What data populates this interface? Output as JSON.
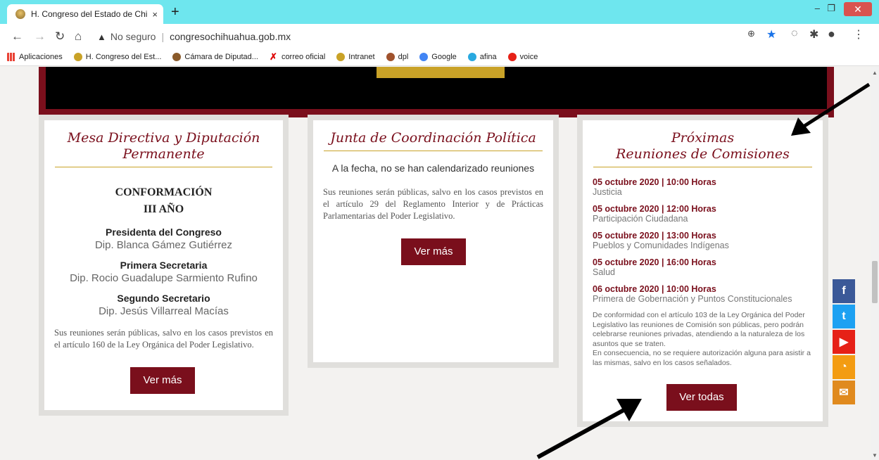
{
  "browser": {
    "tab_title": "H. Congreso del Estado de Chihu",
    "tab_close": "×",
    "new_tab": "+",
    "security_label": "No seguro",
    "url": "congresochihuahua.gob.mx",
    "bookmarks": [
      {
        "label": "Aplicaciones",
        "icon": "apps-grid-icon"
      },
      {
        "label": "H. Congreso del Est...",
        "icon": "congreso-icon"
      },
      {
        "label": "Cámara de Diputad...",
        "icon": "camara-icon"
      },
      {
        "label": "correo oficial",
        "icon": "x-mail-icon"
      },
      {
        "label": "Intranet",
        "icon": "congreso-icon"
      },
      {
        "label": "dpl",
        "icon": "dpl-icon"
      },
      {
        "label": "Google",
        "icon": "google-icon"
      },
      {
        "label": "afina",
        "icon": "afina-icon"
      },
      {
        "label": "voice",
        "icon": "youtube-icon"
      }
    ]
  },
  "cards": {
    "mesa": {
      "title_line1": "Mesa Directiva y Diputación",
      "title_line2": "Permanente",
      "conf_line1": "CONFORMACIÓN",
      "conf_line2": "III AÑO",
      "members": [
        {
          "role": "Presidenta del Congreso",
          "name": "Dip. Blanca Gámez Gutiérrez"
        },
        {
          "role": "Primera Secretaria",
          "name": "Dip. Rocio Guadalupe Sarmiento Rufino"
        },
        {
          "role": "Segundo Secretario",
          "name": "Dip. Jesús Villarreal Macías"
        }
      ],
      "note": "Sus reuniones serán públicas, salvo en los casos previstos en el artículo 160 de la Ley Orgánica del Poder Legislativo.",
      "button": "Ver más"
    },
    "junta": {
      "title": "Junta de Coordinación Política",
      "no_meetings": "A la fecha, no se han calendarizado reuniones",
      "note": "Sus reuniones serán públicas, salvo en los casos previstos en el artículo 29 del Reglamento Interior y de Prácticas Parlamentarias del Poder Legislativo.",
      "button": "Ver más"
    },
    "comisiones": {
      "title_line1": "Próximas",
      "title_line2": "Reuniones de Comisiones",
      "meetings": [
        {
          "date": "05 octubre 2020 | 10:00 Horas",
          "committee": "Justicia"
        },
        {
          "date": "05 octubre 2020 | 12:00 Horas",
          "committee": "Participación Ciudadana"
        },
        {
          "date": "05 octubre 2020 | 13:00 Horas",
          "committee": "Pueblos y Comunidades Indígenas"
        },
        {
          "date": "05 octubre 2020 | 16:00 Horas",
          "committee": "Salud"
        },
        {
          "date": "06 octubre 2020 | 10:00 Horas",
          "committee": "Primera de Gobernación y Puntos Constitucionales"
        }
      ],
      "legal_1": "De conformidad con el artículo 103 de la Ley Orgánica del Poder Legislativo las reuniones de Comisión son públicas, pero podrán celebrarse reuniones privadas, atendiendo a la naturaleza de los asuntos que se traten.",
      "legal_2": "En consecuencia, no se requiere autorización alguna para asistir a las mismas, salvo en los casos señalados.",
      "button": "Ver todas"
    }
  },
  "social": [
    {
      "name": "facebook-icon",
      "glyph": "f",
      "color": "#3b5998"
    },
    {
      "name": "twitter-icon",
      "glyph": "t",
      "color": "#1da1f2"
    },
    {
      "name": "youtube-icon",
      "glyph": "▶",
      "color": "#e62117"
    },
    {
      "name": "rss-icon",
      "glyph": "◔",
      "color": "#f39c12"
    },
    {
      "name": "mail-icon",
      "glyph": "✉",
      "color": "#e08a1e"
    }
  ]
}
